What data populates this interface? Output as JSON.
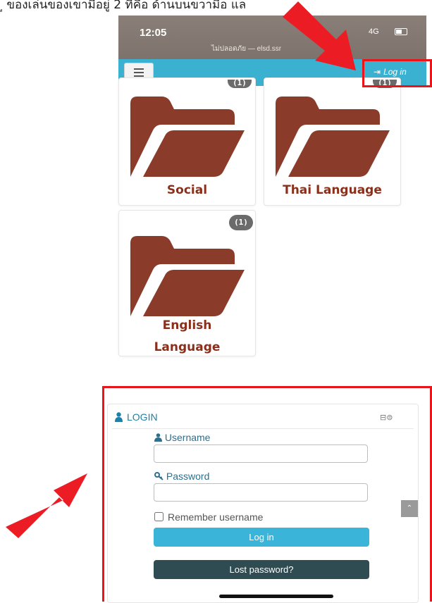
{
  "caption": "ู ของเล่นของเขามีอยู่ 2 ที่คือ ด้านบนขวามือ แล",
  "status_bar": {
    "time": "12:05",
    "url": "ไม่ปลอดภัย — elsd.ssr",
    "signal": "4G"
  },
  "navbar": {
    "login_link": "Log in"
  },
  "categories": [
    {
      "badge": "(1)",
      "name": "Social"
    },
    {
      "badge": "(1)",
      "name": "Thai Language"
    },
    {
      "badge": "(1)",
      "name_line1": "English",
      "name_line2": "Language"
    }
  ],
  "login_block": {
    "title": "LOGIN",
    "username_label": "Username",
    "username_value": "",
    "password_label": "Password",
    "password_value": "",
    "remember_label": "Remember username",
    "login_button": "Log in",
    "lost_password_button": "Lost password?"
  },
  "colors": {
    "navbar": "#3ab1d0",
    "folder": "#8b3b2a",
    "highlight": "#e8161b",
    "login_button": "#3ab4d8",
    "lost_password_button": "#2f4c53"
  },
  "icons": [
    "menu-icon",
    "sign-in-icon",
    "folder-icon",
    "user-icon",
    "key-icon",
    "arrow-icon"
  ]
}
